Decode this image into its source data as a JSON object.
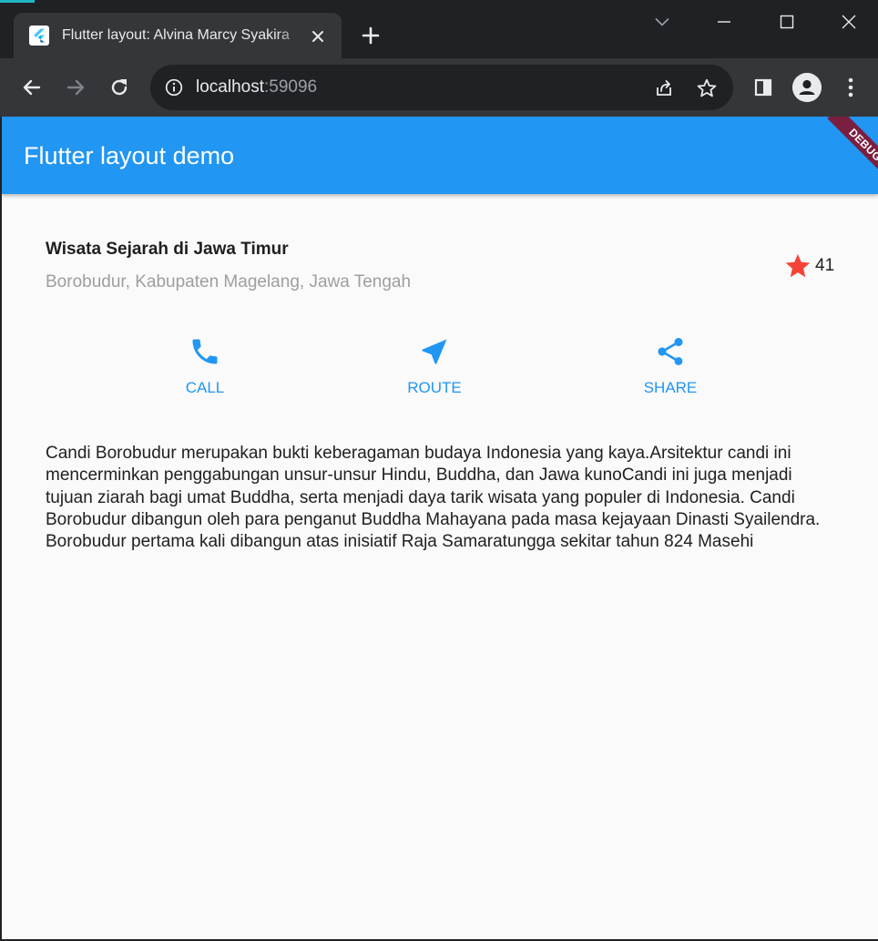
{
  "browser": {
    "tab_title": "Flutter layout: Alvina Marcy Syakira",
    "url_host": "localhost",
    "url_port": ":59096"
  },
  "app": {
    "title": "Flutter layout demo",
    "debug_banner": "DEBUG",
    "colors": {
      "primary": "#2196f3",
      "star": "#f44336",
      "banner": "#7a1f3f"
    }
  },
  "place": {
    "title": "Wisata Sejarah di Jawa Timur",
    "subtitle": "Borobudur, Kabupaten Magelang, Jawa Tengah",
    "rating_count": "41"
  },
  "actions": [
    {
      "label": "CALL",
      "icon": "phone-icon"
    },
    {
      "label": "ROUTE",
      "icon": "near-me-icon"
    },
    {
      "label": "SHARE",
      "icon": "share-icon"
    }
  ],
  "description": "Candi Borobudur merupakan bukti keberagaman budaya Indonesia yang kaya.Arsitektur candi ini mencerminkan penggabungan unsur-unsur Hindu, Buddha, dan Jawa kunoCandi ini juga menjadi tujuan ziarah bagi umat Buddha, serta menjadi daya tarik wisata yang populer di Indonesia. Candi Borobudur dibangun oleh para penganut Buddha Mahayana pada masa kejayaan Dinasti Syailendra. Borobudur pertama kali dibangun atas inisiatif Raja Samaratungga sekitar tahun 824 Masehi"
}
